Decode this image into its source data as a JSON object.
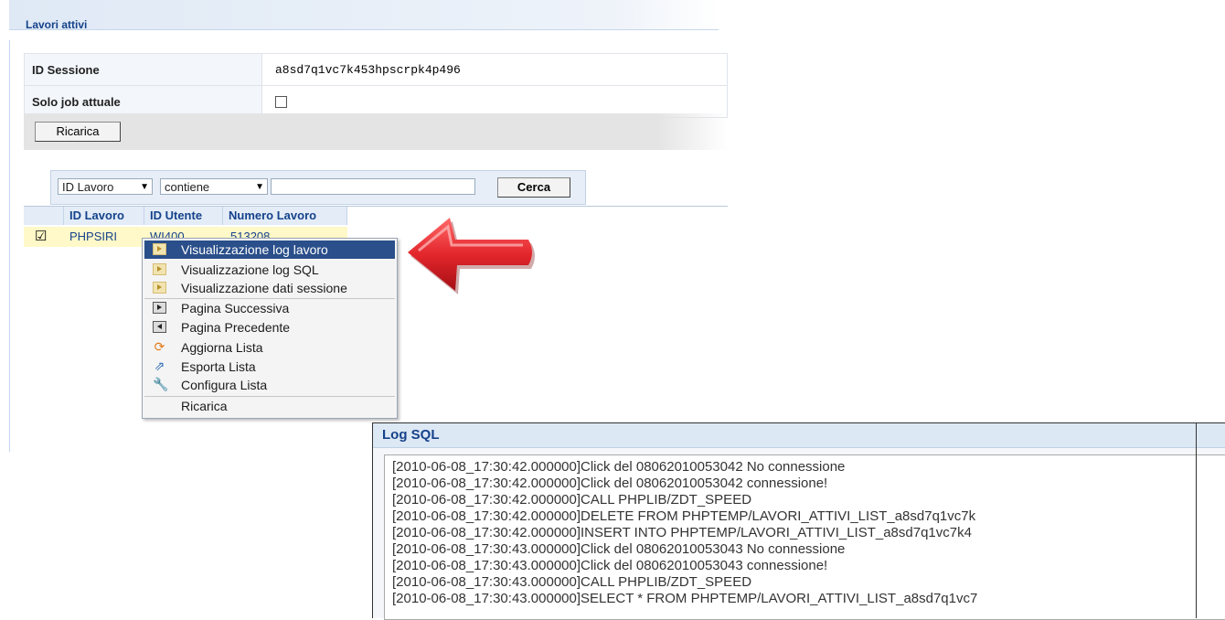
{
  "panel": {
    "title": "Lavori attivi"
  },
  "form": {
    "session_label": "ID Sessione",
    "session_value": "a8sd7q1vc7k453hpscrpk4p496",
    "onlyjob_label": "Solo job attuale",
    "reload_label": "Ricarica"
  },
  "filter": {
    "field_value": "ID Lavoro",
    "operator_value": "contiene",
    "search_value": "",
    "search_button": "Cerca"
  },
  "grid": {
    "columns": [
      "ID Lavoro",
      "ID Utente",
      "Numero Lavoro"
    ],
    "row": {
      "checked": true,
      "job_id": "PHPSIRI",
      "user_id": "WI400",
      "job_number": "513208"
    }
  },
  "context_menu": {
    "items": [
      "Visualizzazione log lavoro",
      "Visualizzazione log SQL",
      "Visualizzazione dati sessione",
      "Pagina Successiva",
      "Pagina Precedente",
      "Aggiorna Lista",
      "Esporta Lista",
      "Configura Lista",
      "Ricarica"
    ],
    "active_item": "Visualizzazione log lavoro"
  },
  "log_window": {
    "title": "Log SQL",
    "lines": [
      "[2010-06-08_17:30:42.000000]Click del 08062010053042 No connessione",
      "[2010-06-08_17:30:42.000000]Click del 08062010053042 connessione!",
      "[2010-06-08_17:30:42.000000]CALL PHPLIB/ZDT_SPEED",
      "[2010-06-08_17:30:42.000000]DELETE FROM PHPTEMP/LAVORI_ATTIVI_LIST_a8sd7q1vc7k",
      "[2010-06-08_17:30:42.000000]INSERT INTO PHPTEMP/LAVORI_ATTIVI_LIST_a8sd7q1vc7k4",
      "[2010-06-08_17:30:43.000000]Click del 08062010053043 No connessione",
      "[2010-06-08_17:30:43.000000]Click del 08062010053043 connessione!",
      "[2010-06-08_17:30:43.000000]CALL PHPLIB/ZDT_SPEED",
      "[2010-06-08_17:30:43.000000]SELECT * FROM PHPTEMP/LAVORI_ATTIVI_LIST_a8sd7q1vc7"
    ]
  },
  "colors": {
    "accent": "#15428b",
    "menu_active": "#2a4f8a",
    "arrow": "#e3262c",
    "row_highlight": "#fff8c8"
  },
  "icons": {
    "menu": [
      "document-icon",
      "document-icon",
      "document-icon",
      "next-page-icon",
      "previous-page-icon",
      "refresh-icon",
      "export-icon",
      "configure-icon",
      ""
    ]
  }
}
